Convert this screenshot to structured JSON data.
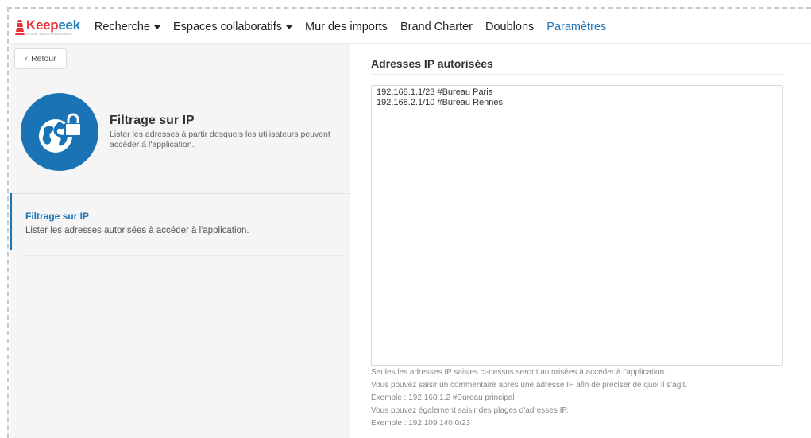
{
  "brand": {
    "name_part1": "Keep",
    "name_part2": "eek",
    "tagline": "DIGITAL MEDIA MANAGEMENT"
  },
  "nav": {
    "items": [
      {
        "label": "Recherche",
        "has_caret": true,
        "active": false
      },
      {
        "label": "Espaces collaboratifs",
        "has_caret": true,
        "active": false
      },
      {
        "label": "Mur des imports",
        "has_caret": false,
        "active": false
      },
      {
        "label": "Brand Charter",
        "has_caret": false,
        "active": false
      },
      {
        "label": "Doublons",
        "has_caret": false,
        "active": false
      },
      {
        "label": "Paramètres",
        "has_caret": false,
        "active": true
      }
    ]
  },
  "back_button": {
    "label": "Retour"
  },
  "header": {
    "title": "Filtrage sur IP",
    "description": "Lister les adresses à partir desquels les utilisateurs peuvent accéder à l'application."
  },
  "menu": {
    "items": [
      {
        "title": "Filtrage sur IP",
        "description": "Lister les adresses autorisées à accéder à l'application."
      }
    ]
  },
  "ip_section": {
    "title": "Adresses IP autorisées",
    "value": "192.168.1.1/23 #Bureau Paris\n192.168.2.1/10 #Bureau Rennes",
    "help_lines": [
      "Seules les adresses IP saisies ci-dessus seront autorisées à accéder à l'application.",
      "Vous pouvez saisir un commentaire après une adresse IP afin de préciser de quoi il s'agit.",
      "Exemple : 192.168.1.2 #Bureau principal",
      "Vous pouvez également saisir des plages d'adresses IP.",
      "Exemple : 192.109.140.0/23"
    ]
  },
  "colors": {
    "accent": "#1a73b5",
    "brand_red": "#e8333a",
    "panel_bg": "#f5f5f5"
  }
}
